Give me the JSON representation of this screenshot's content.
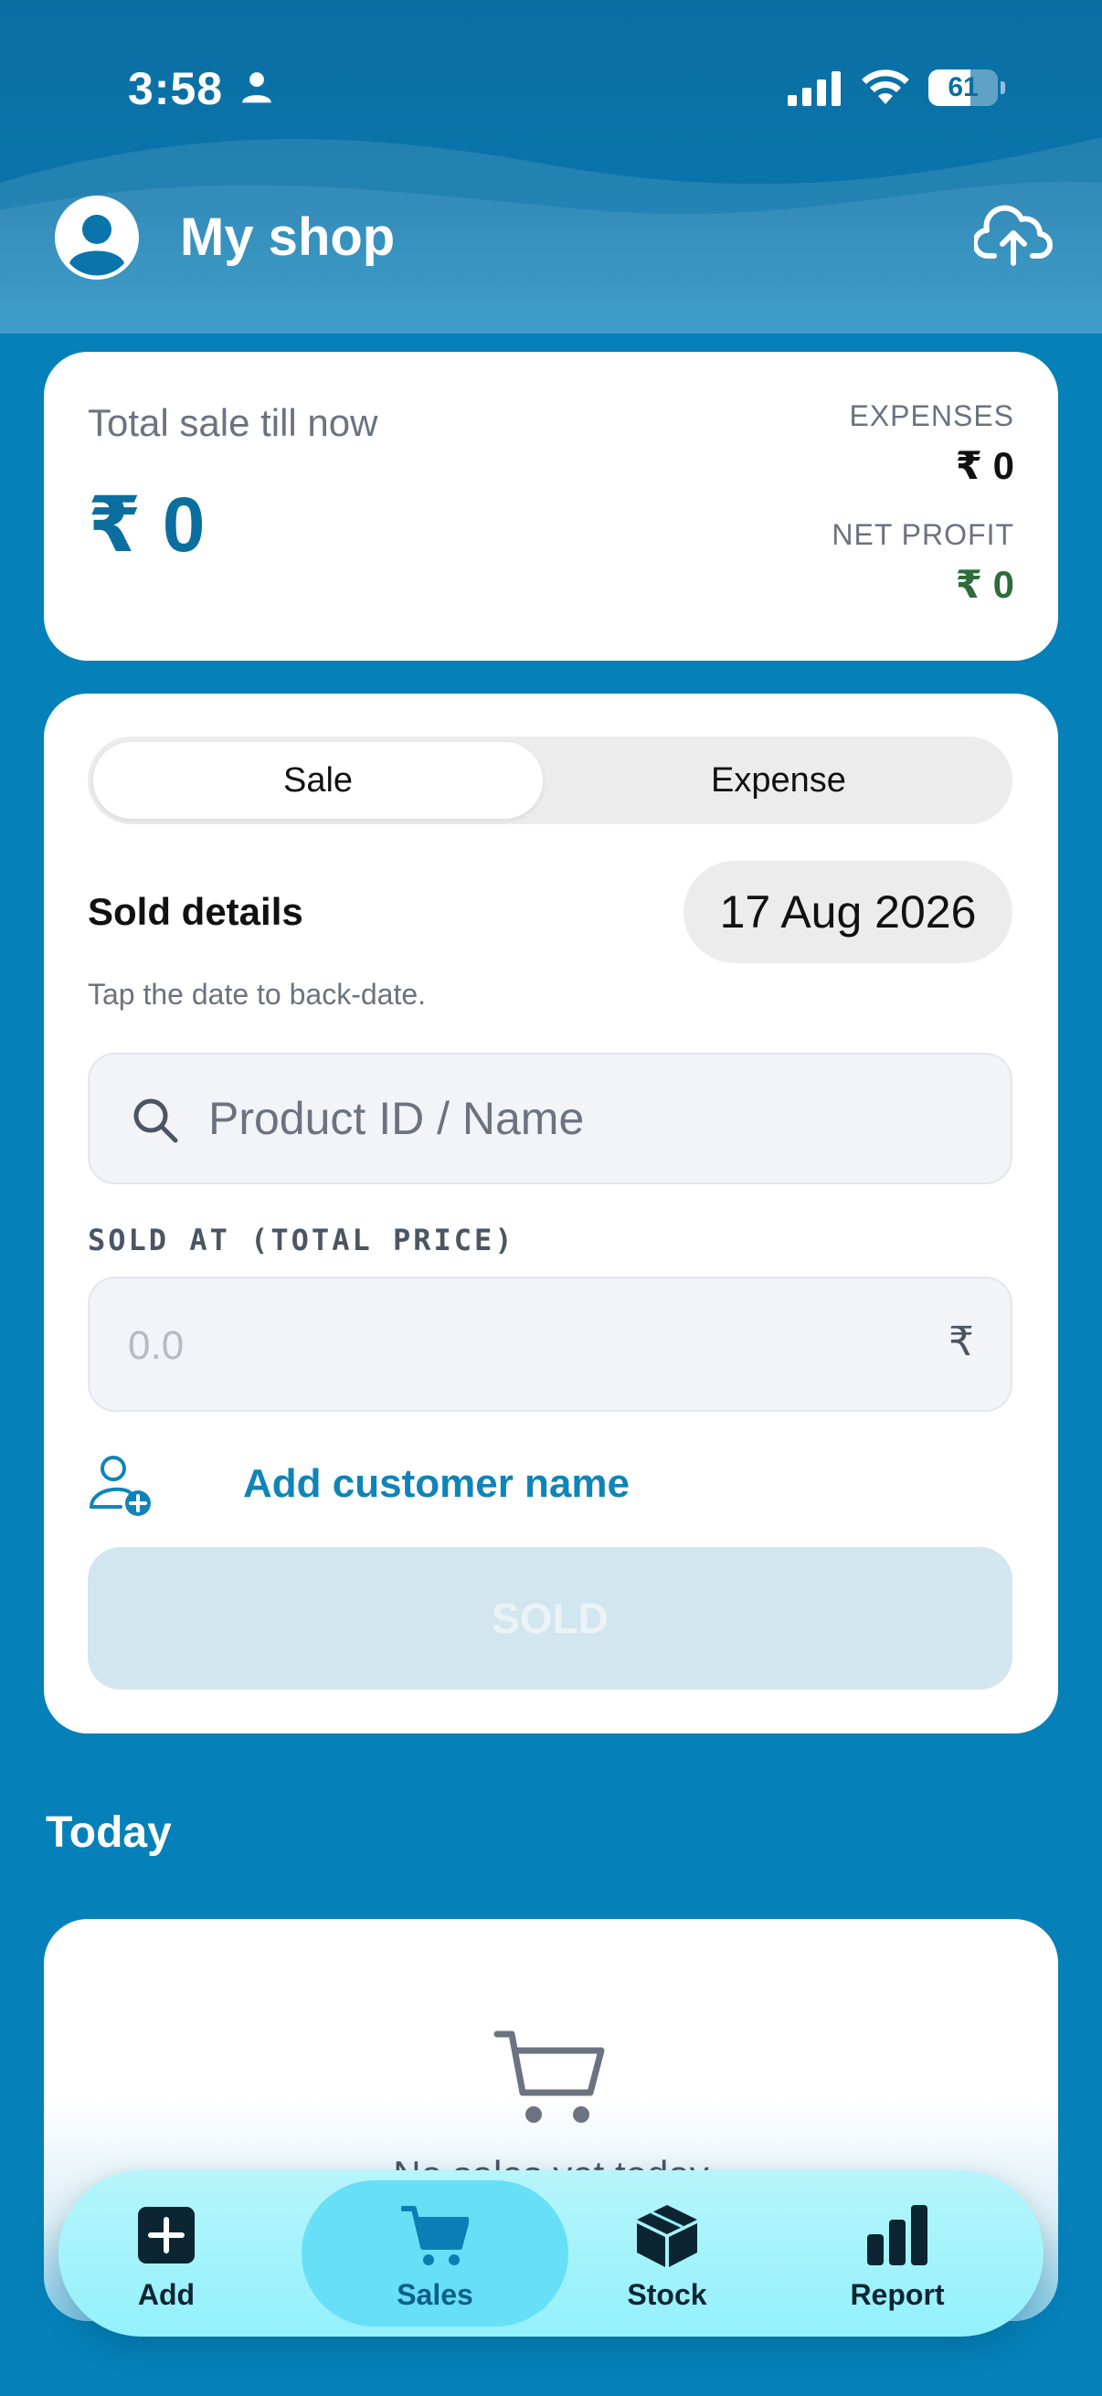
{
  "status_bar": {
    "time": "3:58",
    "battery": "61",
    "battery_level": 0.61
  },
  "header": {
    "title": "My shop"
  },
  "summary": {
    "total_label": "Total sale till now",
    "total_value": "₹ 0",
    "expenses_label": "EXPENSES",
    "expenses_value": "₹ 0",
    "net_profit_label": "NET PROFIT",
    "net_profit_value": "₹ 0"
  },
  "entry": {
    "tabs": [
      {
        "label": "Sale",
        "selected": true
      },
      {
        "label": "Expense",
        "selected": false
      }
    ],
    "section_title": "Sold details",
    "date": "17 Aug 2026",
    "hint": "Tap the date to back-date.",
    "search_placeholder": "Product ID / Name",
    "price_label": "SOLD AT (TOTAL PRICE)",
    "price_placeholder": "0.0",
    "currency_symbol": "₹",
    "add_customer_label": "Add customer name",
    "submit_label": "SOLD"
  },
  "today": {
    "heading": "Today",
    "empty_text": "No sales yet today"
  },
  "bottom_nav": {
    "items": [
      {
        "label": "Add",
        "icon": "plus-square-icon",
        "active": false
      },
      {
        "label": "Sales",
        "icon": "cart-icon",
        "active": true
      },
      {
        "label": "Stock",
        "icon": "box-icon",
        "active": false
      },
      {
        "label": "Report",
        "icon": "bar-chart-icon",
        "active": false
      }
    ]
  },
  "colors": {
    "background": "#0580b8",
    "primary_text": "#0a6f9e",
    "accent_link": "#1084b7",
    "profit_green": "#2e6b3e",
    "nav_bar": "#93f1fb",
    "nav_active": "#67dff7"
  }
}
